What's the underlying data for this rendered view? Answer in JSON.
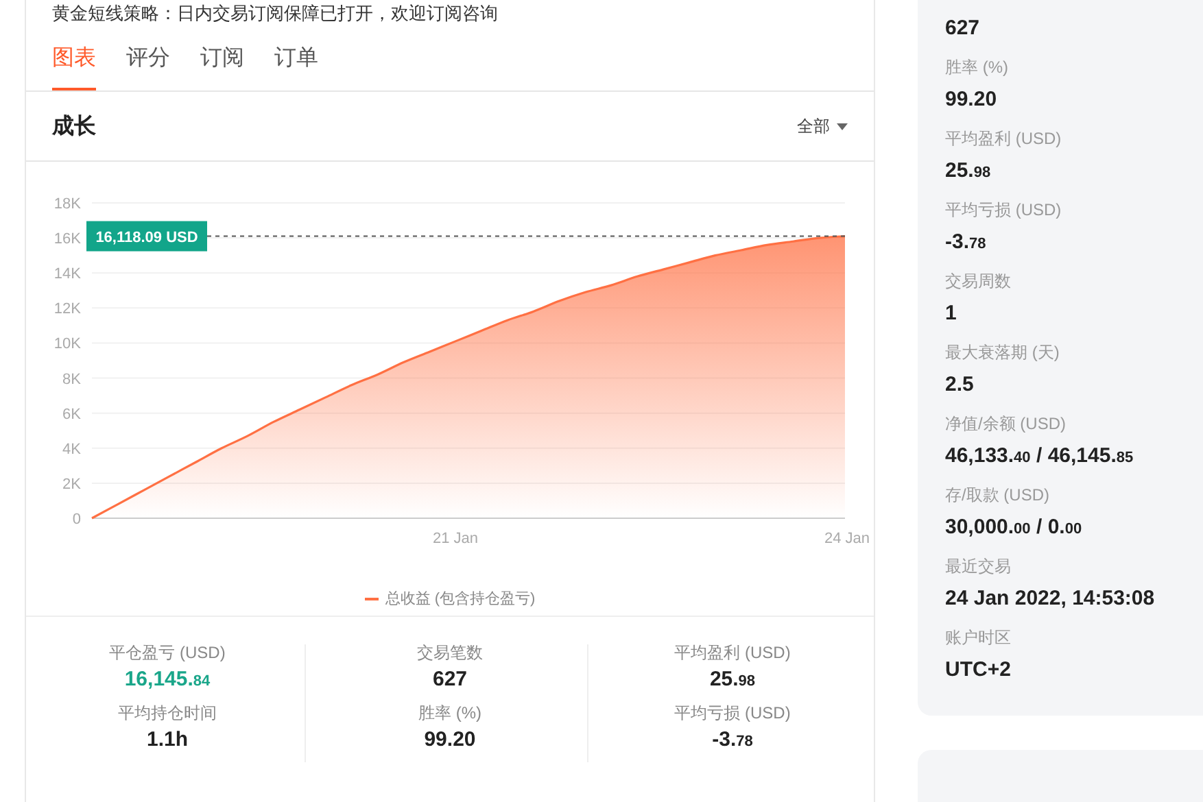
{
  "notice": "黄金短线策略：日内交易订阅保障已打开，欢迎订阅咨询",
  "tabs": [
    {
      "label": "图表",
      "selected": true
    },
    {
      "label": "评分",
      "selected": false
    },
    {
      "label": "订阅",
      "selected": false
    },
    {
      "label": "订单",
      "selected": false
    }
  ],
  "growth": {
    "title": "成长",
    "range_dropdown": "全部",
    "chart_data": {
      "type": "area",
      "categories": [
        null,
        null,
        null,
        null,
        null,
        null,
        null,
        null,
        null,
        null,
        null,
        null,
        null,
        null,
        "21 Jan",
        null,
        null,
        null,
        null,
        null,
        null,
        null,
        null,
        null,
        null,
        null,
        null,
        null,
        null,
        "24 Jan"
      ],
      "series": [
        {
          "name": "总收益 (包含持仓盈亏)",
          "color": "#ff7043",
          "values": [
            0,
            800,
            1600,
            2400,
            3200,
            4000,
            4700,
            5500,
            6200,
            6900,
            7600,
            8200,
            8900,
            9500,
            10100,
            10700,
            11300,
            11800,
            12400,
            12900,
            13300,
            13800,
            14200,
            14600,
            15000,
            15300,
            15600,
            15800,
            16000,
            16100
          ]
        }
      ],
      "grid": true,
      "ylim": [
        0,
        18000
      ],
      "yticks": [
        {
          "value": 0,
          "label": "0"
        },
        {
          "value": 2000,
          "label": "2K"
        },
        {
          "value": 4000,
          "label": "4K"
        },
        {
          "value": 6000,
          "label": "6K"
        },
        {
          "value": 8000,
          "label": "8K"
        },
        {
          "value": 10000,
          "label": "10K"
        },
        {
          "value": 12000,
          "label": "12K"
        },
        {
          "value": 14000,
          "label": "14K"
        },
        {
          "value": 16000,
          "label": "16K"
        },
        {
          "value": 18000,
          "label": "18K"
        }
      ],
      "annotations": [
        "16,118.09 USD"
      ]
    }
  },
  "summary": [
    {
      "label": "平仓盈亏 (USD)",
      "color": "#1aa68a",
      "parts": [
        {
          "text": "16,145.",
          "small": false
        },
        {
          "text": "84",
          "small": true
        }
      ]
    },
    {
      "label": "交易笔数",
      "color": "#222222",
      "parts": [
        {
          "text": "627",
          "small": false
        }
      ]
    },
    {
      "label": "平均盈利 (USD)",
      "color": "#222222",
      "parts": [
        {
          "text": "25.",
          "small": false
        },
        {
          "text": "98",
          "small": true
        }
      ]
    },
    {
      "label": "平均持仓时间",
      "color": "#222222",
      "parts": [
        {
          "text": "1.1h",
          "small": false
        }
      ]
    },
    {
      "label": "胜率 (%)",
      "color": "#222222",
      "parts": [
        {
          "text": "99.20",
          "small": false
        }
      ]
    },
    {
      "label": "平均亏损 (USD)",
      "color": "#222222",
      "parts": [
        {
          "text": "-3.",
          "small": false
        },
        {
          "text": "78",
          "small": true
        }
      ]
    }
  ],
  "sidebar_stats": [
    {
      "parts": [
        {
          "text": "627",
          "small": false
        }
      ]
    },
    {
      "label": "胜率 (%)",
      "parts": [
        {
          "text": "99.20",
          "small": false
        }
      ]
    },
    {
      "label": "平均盈利 (USD)",
      "parts": [
        {
          "text": "25.",
          "small": false
        },
        {
          "text": "98",
          "small": true
        }
      ]
    },
    {
      "label": "平均亏损 (USD)",
      "parts": [
        {
          "text": "-3.",
          "small": false
        },
        {
          "text": "78",
          "small": true
        }
      ]
    },
    {
      "label": "交易周数",
      "parts": [
        {
          "text": "1",
          "small": false
        }
      ]
    },
    {
      "label": "最大衰落期 (天)",
      "parts": [
        {
          "text": "2.5",
          "small": false
        }
      ]
    },
    {
      "label": "净值/余额 (USD)",
      "parts": [
        {
          "text": "46,133.",
          "small": false
        },
        {
          "text": "40",
          "small": true
        },
        {
          "text": " / ",
          "small": false
        },
        {
          "text": "46,145.",
          "small": false
        },
        {
          "text": "85",
          "small": true
        }
      ]
    },
    {
      "label": "存/取款 (USD)",
      "parts": [
        {
          "text": "30,000.",
          "small": false
        },
        {
          "text": "00",
          "small": true
        },
        {
          "text": " / ",
          "small": false
        },
        {
          "text": "0.",
          "small": false
        },
        {
          "text": "00",
          "small": true
        }
      ]
    },
    {
      "label": "最近交易",
      "parts": [
        {
          "text": "24 Jan 2022, 14:53:08",
          "small": false
        }
      ]
    },
    {
      "label": "账户时区",
      "parts": [
        {
          "text": "UTC+2",
          "small": false
        }
      ]
    }
  ]
}
